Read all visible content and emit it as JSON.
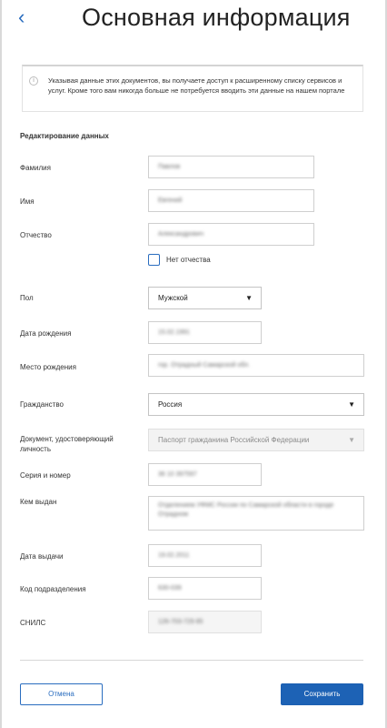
{
  "header": {
    "title": "Основная информация",
    "back_icon": "‹"
  },
  "notice": {
    "icon": "i",
    "text": "Указывая данные этих документов, вы получаете доступ к расширенному списку сервисов и услуг. Кроме того вам никогда больше не потребуется вводить эти данные на нашем портале"
  },
  "form": {
    "section_title": "Редактирование данных",
    "surname": {
      "label": "Фамилия",
      "value": "Павлов"
    },
    "name": {
      "label": "Имя",
      "value": "Евгений"
    },
    "patronymic": {
      "label": "Отчество",
      "value": "Александрович"
    },
    "no_patronymic_label": "Нет отчества",
    "gender": {
      "label": "Пол",
      "value": "Мужской"
    },
    "birth_date": {
      "label": "Дата рождения",
      "value": "15.02.1991"
    },
    "birth_place": {
      "label": "Место рождения",
      "value": "гор. Отрадный Самарской обл."
    },
    "citizenship": {
      "label": "Гражданство",
      "value": "Россия"
    },
    "document": {
      "label": "Документ, удостоверяющий личность",
      "value": "Паспорт гражданина Российской Федерации"
    },
    "series_number": {
      "label": "Серия и номер",
      "value": "36 10 397597"
    },
    "issued_by": {
      "label": "Кем выдан",
      "value": "Отделением УФМС России по Самарской области в городе Отрадном"
    },
    "issue_date": {
      "label": "Дата выдачи",
      "value": "19.02.2011"
    },
    "division_code": {
      "label": "Код подразделения",
      "value": "630-039"
    },
    "snils": {
      "label": "СНИЛС",
      "value": "126-703-729 85"
    }
  },
  "footer": {
    "cancel_label": "Отмена",
    "save_label": "Сохранить"
  },
  "colors": {
    "accent": "#1d62b5",
    "link": "#2a6dbf"
  }
}
